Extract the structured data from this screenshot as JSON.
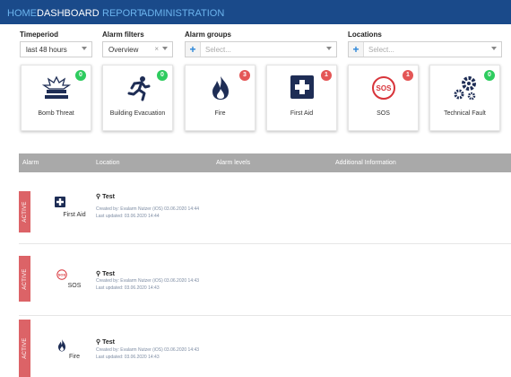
{
  "nav": {
    "items": [
      "HOME",
      "DASHBOARD",
      "REPORT",
      "ADMINISTRATION"
    ],
    "active": "DASHBOARD"
  },
  "filters": {
    "timeperiod": {
      "label": "Timeperiod",
      "value": "last 48 hours"
    },
    "alarm_filters": {
      "label": "Alarm filters",
      "value": "Overview",
      "clear": "×"
    },
    "alarm_groups": {
      "label": "Alarm groups",
      "placeholder": "Select..."
    },
    "locations": {
      "label": "Locations",
      "placeholder": "Select..."
    }
  },
  "cards": [
    {
      "name": "Bomb Threat",
      "count": "0",
      "badge": "green",
      "icon": "bomb-threat-icon"
    },
    {
      "name": "Building Evacuation",
      "count": "0",
      "badge": "green",
      "icon": "running-person-icon"
    },
    {
      "name": "Fire",
      "count": "3",
      "badge": "red",
      "icon": "fire-icon"
    },
    {
      "name": "First Aid",
      "count": "1",
      "badge": "red",
      "icon": "first-aid-icon"
    },
    {
      "name": "SOS",
      "count": "1",
      "badge": "red",
      "icon": "sos-icon"
    },
    {
      "name": "Technical Fault",
      "count": "0",
      "badge": "green",
      "icon": "gears-icon"
    }
  ],
  "table": {
    "headers": {
      "alarm": "Alarm",
      "location": "Location",
      "levels": "Alarm levels",
      "info": "Additional Information"
    },
    "rows": [
      {
        "status": "ACTIVE",
        "name": "First Aid",
        "icon": "first-aid-icon",
        "location": "Test",
        "created": "Created by: Evalarm Nutzer (iOS) 03.06.2020 14:44",
        "updated": "Last updated: 03.06.2020 14:44"
      },
      {
        "status": "ACTIVE",
        "name": "SOS",
        "icon": "sos-icon",
        "location": "Test",
        "created": "Created by: Evalarm Nutzer (iOS) 03.06.2020 14:43",
        "updated": "Last updated: 03.06.2020 14:43"
      },
      {
        "status": "ACTIVE",
        "name": "Fire",
        "icon": "fire-icon",
        "location": "Test",
        "created": "Created by: Evalarm Nutzer (iOS) 03.06.2020 14:43",
        "updated": "Last updated: 03.06.2020 14:43"
      }
    ]
  },
  "colors": {
    "nav_bg": "#1a4a8a",
    "nav_link": "#6cb4ee",
    "badge_green": "#2ecc5f",
    "badge_red": "#e45656",
    "status_red": "#dc6367",
    "header_gray": "#a9a9a9",
    "accent_blue": "#2a86d8"
  }
}
